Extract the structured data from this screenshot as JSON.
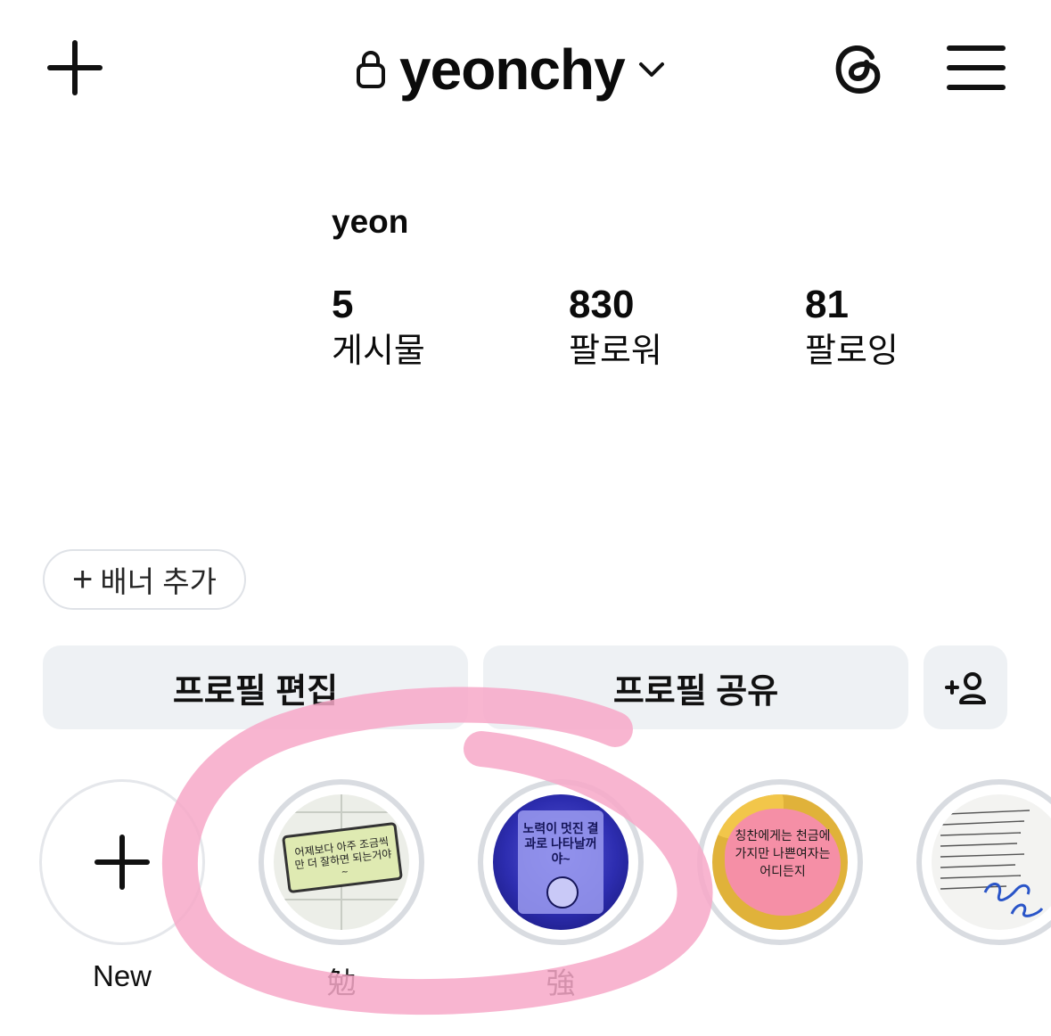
{
  "header": {
    "username": "yeonchy",
    "icons": [
      "plus-icon",
      "lock-icon",
      "chevron-down-icon",
      "threads-icon",
      "menu-icon"
    ]
  },
  "profile": {
    "display_name": "yeon",
    "stats": [
      {
        "value": "5",
        "label": "게시물"
      },
      {
        "value": "830",
        "label": "팔로워"
      },
      {
        "value": "81",
        "label": "팔로잉"
      }
    ]
  },
  "banner": {
    "label": "배너 추가"
  },
  "actions": {
    "edit_profile": "프로필 편집",
    "share_profile": "프로필 공유",
    "add_person_icon": "add-person-icon"
  },
  "highlights": [
    {
      "label": "New"
    },
    {
      "label": "勉",
      "image_text": "어제보다 아주 조금씩만 더 잘하면 되는거야~"
    },
    {
      "label": "強",
      "image_text": "노력이 멋진 결과로 나타날꺼야~"
    },
    {
      "label": "",
      "image_text": "칭찬에게는 천금에 가지만 나쁜여자는 어디든지"
    },
    {
      "label": ""
    }
  ],
  "colors": {
    "button_bg": "#eef1f4",
    "ring": "#d9dce1",
    "annotation": "#f7a8c8"
  }
}
